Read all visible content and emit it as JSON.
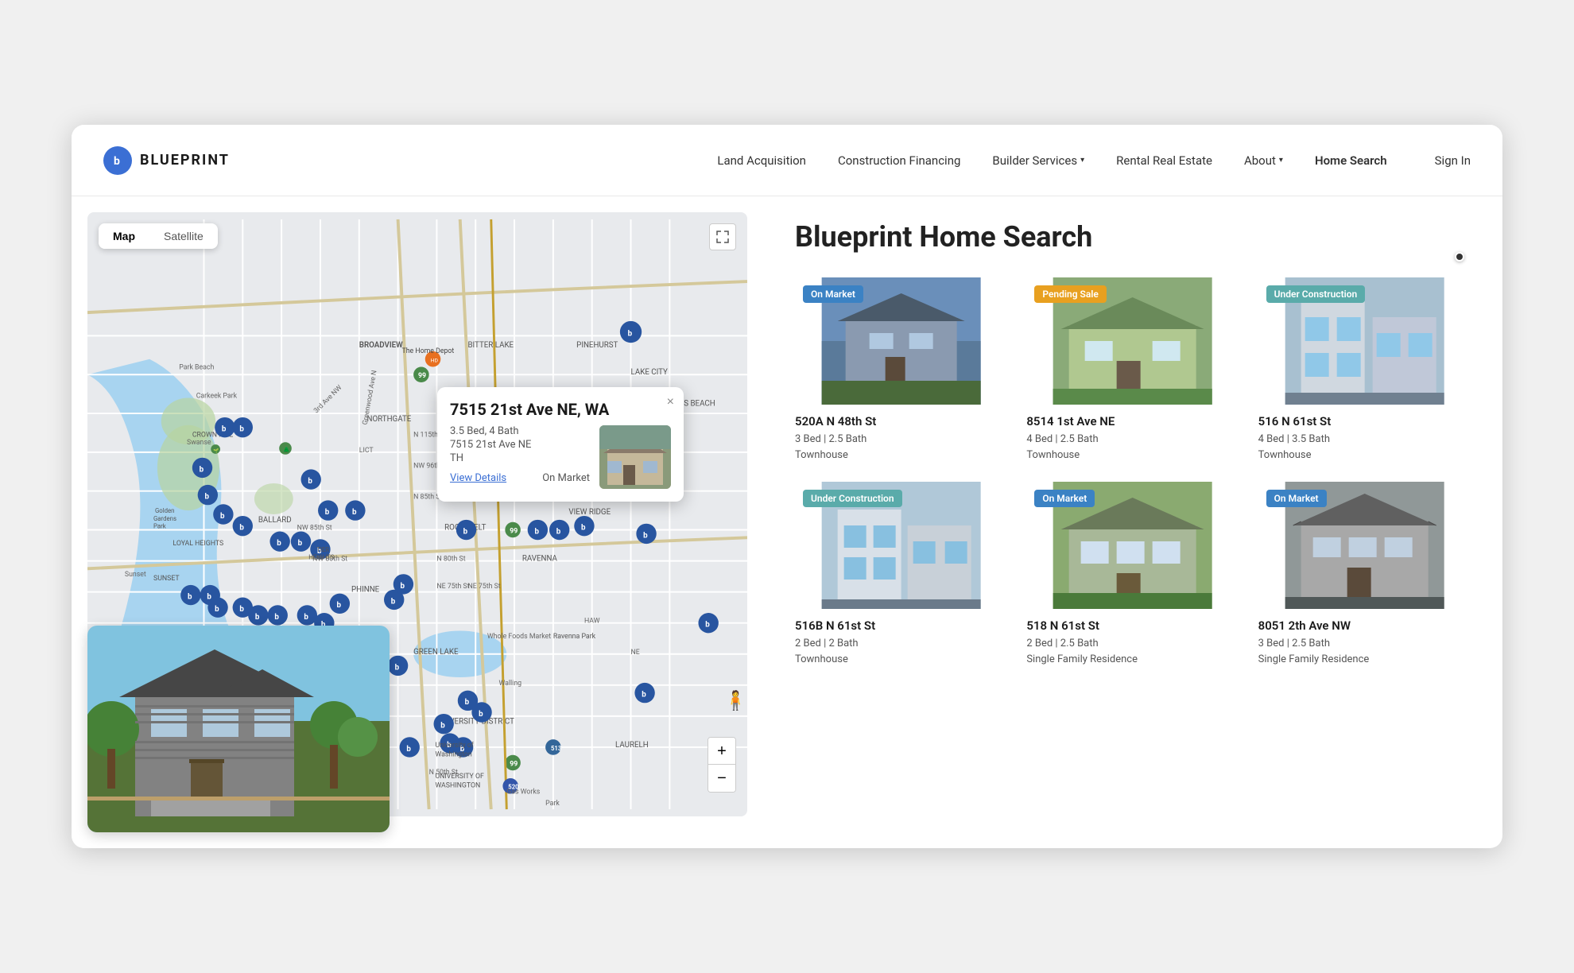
{
  "nav": {
    "logo_letter": "b",
    "logo_text": "BLUEPRINT",
    "links": [
      {
        "label": "Land Acquisition",
        "has_dropdown": false
      },
      {
        "label": "Construction Financing",
        "has_dropdown": false
      },
      {
        "label": "Builder Services",
        "has_dropdown": true
      },
      {
        "label": "Rental Real Estate",
        "has_dropdown": false
      },
      {
        "label": "About",
        "has_dropdown": true
      },
      {
        "label": "Home Search",
        "has_dropdown": false
      },
      {
        "label": "Sign In",
        "has_dropdown": false
      }
    ]
  },
  "map": {
    "toggle_map": "Map",
    "toggle_satellite": "Satellite",
    "expand_icon": "⛶",
    "zoom_in": "+",
    "zoom_out": "−"
  },
  "popup": {
    "address": "7515 21st Ave NE, WA",
    "beds": "3.5 Bed, 4 Bath",
    "street": "7515 21st Ave NE",
    "type": "TH",
    "view_details": "View Details",
    "status": "On Market",
    "close": "×"
  },
  "listings": {
    "title": "Blueprint Home Search",
    "cards": [
      {
        "badge": "On Market",
        "badge_class": "badge-on-market",
        "address": "520A N 48th St",
        "beds": "3 Bed | 2.5 Bath",
        "type": "Townhouse",
        "bg_color": "#6a8fba",
        "bg_color2": "#4a6a8a"
      },
      {
        "badge": "Pending Sale",
        "badge_class": "badge-pending-sale",
        "address": "8514 1st Ave NE",
        "beds": "4 Bed | 2.5 Bath",
        "type": "Townhouse",
        "bg_color": "#8aaa78",
        "bg_color2": "#5a7a4e"
      },
      {
        "badge": "Under Construction",
        "badge_class": "badge-under-construction",
        "address": "516 N 61st St",
        "beds": "4 Bed | 3.5 Bath",
        "type": "Townhouse",
        "bg_color": "#a0b8c8",
        "bg_color2": "#708090"
      },
      {
        "badge": "Under Construction",
        "badge_class": "badge-under-construction",
        "address": "516B N 61st St",
        "beds": "2 Bed | 2 Bath",
        "type": "Townhouse",
        "bg_color": "#b0c8d8",
        "bg_color2": "#809aaa"
      },
      {
        "badge": "On Market",
        "badge_class": "badge-on-market",
        "address": "518 N 61st St",
        "beds": "2 Bed | 2.5 Bath",
        "type": "Single Family Residence",
        "bg_color": "#8aaa70",
        "bg_color2": "#5a7a40"
      },
      {
        "badge": "On Market",
        "badge_class": "badge-on-market",
        "address": "8051 2th Ave NW",
        "beds": "3 Bed | 2.5 Bath",
        "type": "Single Family Residence",
        "bg_color": "#909898",
        "bg_color2": "#606868"
      }
    ]
  }
}
